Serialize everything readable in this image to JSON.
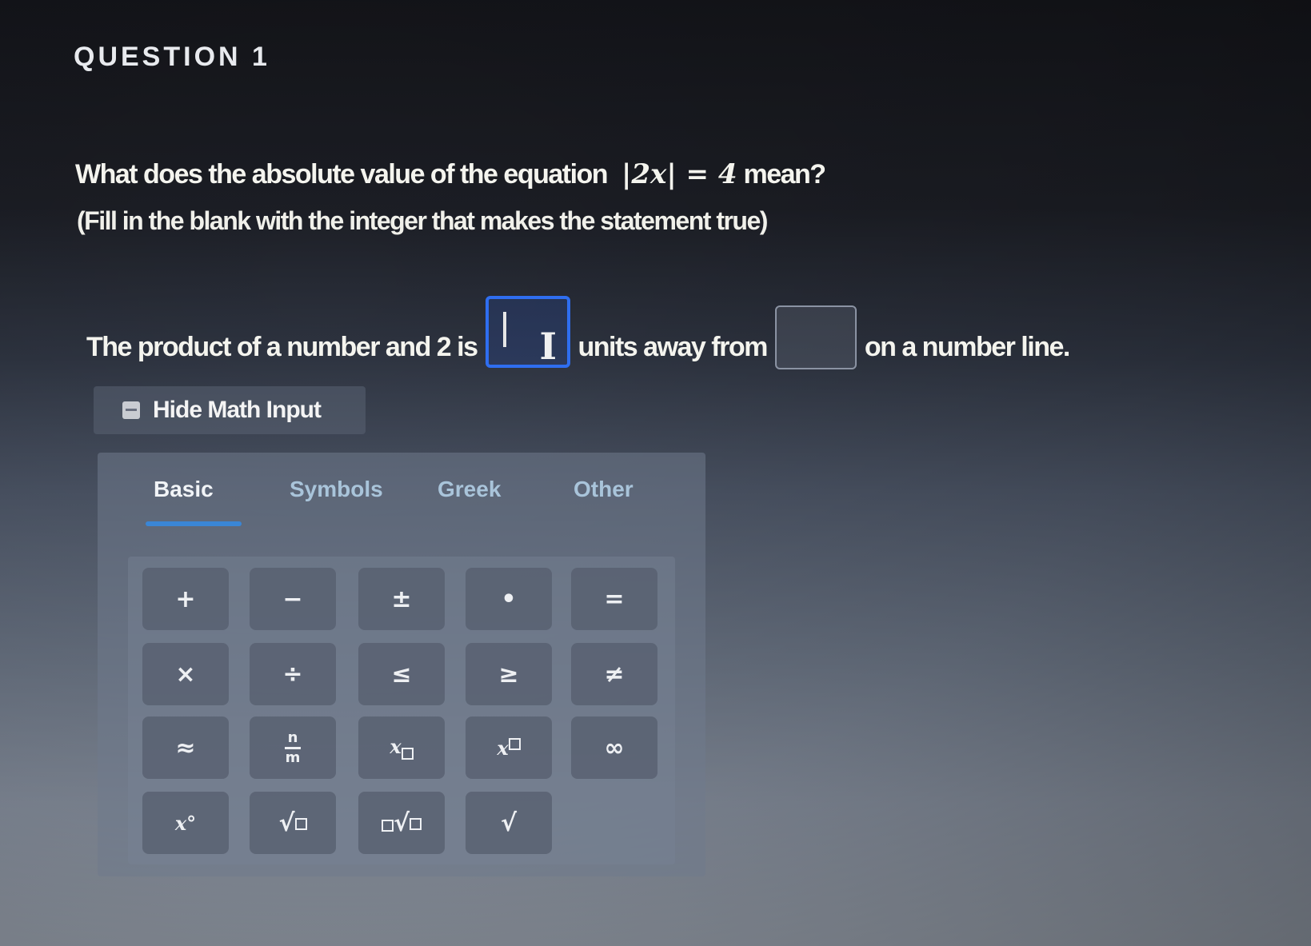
{
  "question": {
    "label": "QUESTION 1",
    "prompt": "What does the absolute value of the equation",
    "equation": "|2x| = 4",
    "prompt_tail": "mean?",
    "instruction": "(Fill in the blank with the integer that makes the statement true)"
  },
  "sentence": {
    "part1": "The product of a number and 2 is",
    "part2": "units away from",
    "part3": "on a number line.",
    "blank1_value": "",
    "blank2_value": ""
  },
  "math_input": {
    "toggle_label": "Hide Math Input",
    "tabs": [
      {
        "label": "Basic",
        "active": true
      },
      {
        "label": "Symbols",
        "active": false
      },
      {
        "label": "Greek",
        "active": false
      },
      {
        "label": "Other",
        "active": false
      }
    ],
    "keys": {
      "plus": "+",
      "minus": "−",
      "plus_minus": "±",
      "dot": "•",
      "equals": "=",
      "times": "×",
      "divide": "÷",
      "leq": "≤",
      "geq": "≥",
      "neq": "≠",
      "approx": "≈",
      "frac_num": "n",
      "frac_den": "m",
      "subscript_base": "x",
      "superscript_base": "x",
      "infinity": "∞",
      "x_degree": "x°",
      "sqrt": "√",
      "nth_root": "√",
      "root_symbol": "√"
    }
  },
  "colors": {
    "accent": "#2f6ef0",
    "tab_underline": "#3a86d6"
  }
}
